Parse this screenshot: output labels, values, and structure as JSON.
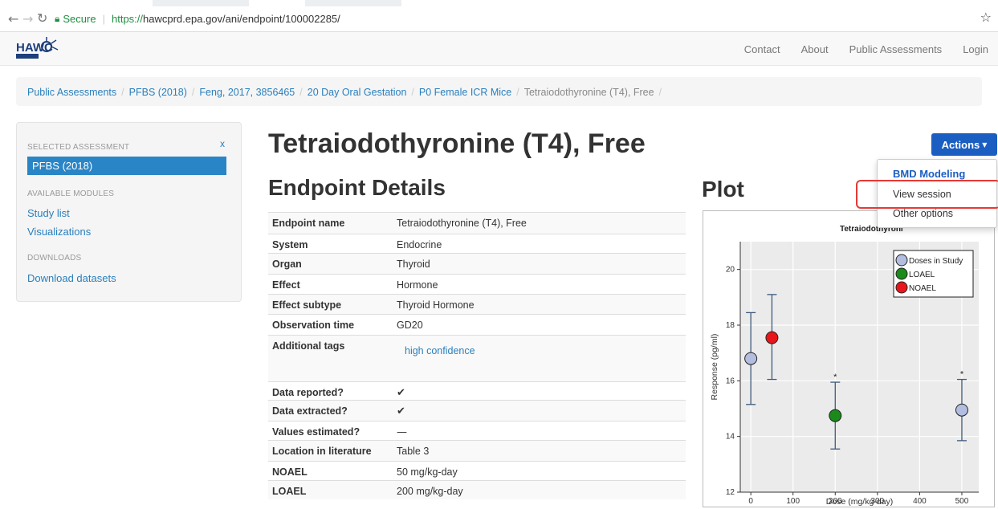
{
  "browser": {
    "back_icon": "arrow-left-icon",
    "forward_icon": "arrow-right-icon",
    "reload_icon": "reload-icon",
    "secure_label": "Secure",
    "url_protocol": "https://",
    "url_rest": "hawcprd.epa.gov/ani/endpoint/100002285/",
    "bookmark_icon": "star-icon"
  },
  "navbar": {
    "logo_text": "HAWC",
    "links": [
      "Contact",
      "About",
      "Public Assessments",
      "Login"
    ]
  },
  "breadcrumb": {
    "items": [
      "Public Assessments",
      "PFBS (2018)",
      "Feng, 2017, 3856465",
      "20 Day Oral Gestation",
      "P0 Female ICR Mice"
    ],
    "active": "Tetraiodothyronine (T4), Free",
    "separator": "/"
  },
  "sidebar": {
    "selected_header": "SELECTED ASSESSMENT",
    "close": "x",
    "selected": "PFBS (2018)",
    "modules_header": "AVAILABLE MODULES",
    "modules": [
      "Study list",
      "Visualizations"
    ],
    "downloads_header": "DOWNLOADS",
    "downloads": [
      "Download datasets"
    ]
  },
  "page": {
    "title": "Tetraiodothyronine (T4), Free",
    "details_heading": "Endpoint Details",
    "plot_heading": "Plot"
  },
  "actions": {
    "label": "Actions",
    "menu_header": "BMD Modeling",
    "items": [
      "View session",
      "Other options"
    ]
  },
  "details": [
    {
      "key": "Endpoint name",
      "value": "Tetraiodothyronine (T4), Free"
    },
    {
      "key": "System",
      "value": "Endocrine"
    },
    {
      "key": "Organ",
      "value": "Thyroid"
    },
    {
      "key": "Effect",
      "value": "Hormone"
    },
    {
      "key": "Effect subtype",
      "value": "Thyroid Hormone"
    },
    {
      "key": "Observation time",
      "value": "GD20"
    },
    {
      "key": "Additional tags",
      "value": "high confidence"
    },
    {
      "key": "Data reported?",
      "value": "✔"
    },
    {
      "key": "Data extracted?",
      "value": "✔"
    },
    {
      "key": "Values estimated?",
      "value": "—"
    },
    {
      "key": "Location in literature",
      "value": "Table 3"
    },
    {
      "key": "NOAEL",
      "value": "50 mg/kg-day"
    },
    {
      "key": "LOAEL",
      "value": "200 mg/kg-day"
    }
  ],
  "chart_data": {
    "type": "scatter",
    "title": "Tetraiodothyroni",
    "xlabel": "Dose (mg/kg-day)",
    "ylabel": "Response (pg/ml)",
    "xlim": [
      -25,
      540
    ],
    "ylim": [
      12,
      21
    ],
    "xticks": [
      0,
      100,
      200,
      300,
      400,
      500
    ],
    "yticks": [
      12,
      14,
      16,
      18,
      20
    ],
    "grid": true,
    "legend_position": "top-right",
    "legend": [
      {
        "name": "Doses in Study",
        "color": "#b3bde0"
      },
      {
        "name": "LOAEL",
        "color": "#1a8a1a"
      },
      {
        "name": "NOAEL",
        "color": "#e8161b"
      }
    ],
    "points": [
      {
        "x": 0,
        "y": 16.8,
        "low": 15.15,
        "high": 18.45,
        "kind": "Doses in Study",
        "significant": false
      },
      {
        "x": 50,
        "y": 17.55,
        "low": 16.05,
        "high": 19.1,
        "kind": "NOAEL",
        "significant": false
      },
      {
        "x": 200,
        "y": 14.75,
        "low": 13.55,
        "high": 15.95,
        "kind": "LOAEL",
        "significant": true
      },
      {
        "x": 500,
        "y": 14.95,
        "low": 13.85,
        "high": 16.05,
        "kind": "Doses in Study",
        "significant": true
      }
    ],
    "significance_marker": "*"
  }
}
